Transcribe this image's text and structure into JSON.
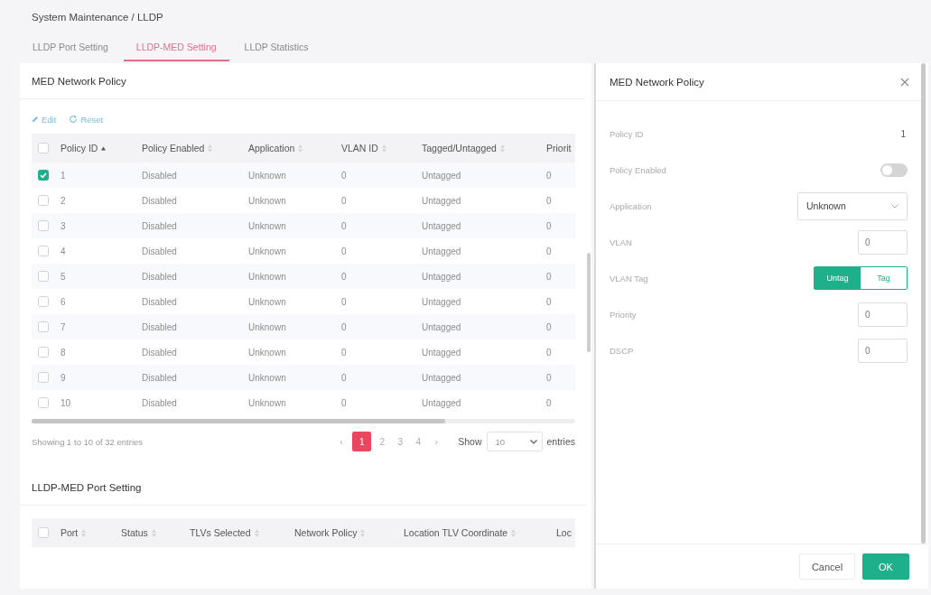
{
  "breadcrumb": "System Maintenance / LLDP",
  "tabs": [
    {
      "label": "LLDP Port Setting",
      "selected": false
    },
    {
      "label": "LLDP-MED Setting",
      "selected": true
    },
    {
      "label": "LLDP Statistics",
      "selected": false
    }
  ],
  "policy_section": {
    "title": "MED Network Policy",
    "toolbar": [
      {
        "kind": "edit",
        "label": "Edit"
      },
      {
        "kind": "reset",
        "label": "Reset"
      }
    ],
    "table": {
      "all_checked": false,
      "columns": [
        {
          "label": "Policy ID",
          "sorted": true
        },
        {
          "label": "Policy Enabled",
          "sorted": false
        },
        {
          "label": "Application",
          "sorted": false
        },
        {
          "label": "VLAN ID",
          "sorted": false
        },
        {
          "label": "Tagged/Untagged",
          "sorted": false
        },
        {
          "label": "Priorit"
        }
      ],
      "rows": [
        {
          "checked": true,
          "cells": [
            "1",
            "Disabled",
            "Unknown",
            "0",
            "Untagged",
            "0"
          ]
        },
        {
          "checked": false,
          "cells": [
            "2",
            "Disabled",
            "Unknown",
            "0",
            "Untagged",
            "0"
          ]
        },
        {
          "checked": false,
          "cells": [
            "3",
            "Disabled",
            "Unknown",
            "0",
            "Untagged",
            "0"
          ]
        },
        {
          "checked": false,
          "cells": [
            "4",
            "Disabled",
            "Unknown",
            "0",
            "Untagged",
            "0"
          ]
        },
        {
          "checked": false,
          "cells": [
            "5",
            "Disabled",
            "Unknown",
            "0",
            "Untagged",
            "0"
          ]
        },
        {
          "checked": false,
          "cells": [
            "6",
            "Disabled",
            "Unknown",
            "0",
            "Untagged",
            "0"
          ]
        },
        {
          "checked": false,
          "cells": [
            "7",
            "Disabled",
            "Unknown",
            "0",
            "Untagged",
            "0"
          ]
        },
        {
          "checked": false,
          "cells": [
            "8",
            "Disabled",
            "Unknown",
            "0",
            "Untagged",
            "0"
          ]
        },
        {
          "checked": false,
          "cells": [
            "9",
            "Disabled",
            "Unknown",
            "0",
            "Untagged",
            "0"
          ]
        },
        {
          "checked": false,
          "cells": [
            "10",
            "Disabled",
            "Unknown",
            "0",
            "Untagged",
            "0"
          ]
        }
      ]
    },
    "footer": {
      "info": "Showing 1 to 10 of 32 entries",
      "prev": "‹",
      "pages": [
        {
          "label": "1",
          "selected": true
        },
        {
          "label": "2",
          "selected": false
        },
        {
          "label": "3",
          "selected": false
        },
        {
          "label": "4",
          "selected": false
        }
      ],
      "next": "›",
      "show_label": "Show",
      "page_size": "10",
      "entries_label": "entries"
    }
  },
  "port_section": {
    "title": "LLDP-MED Port Setting",
    "table": {
      "all_checked": false,
      "columns": [
        {
          "label": "Port",
          "sorted": false
        },
        {
          "label": "Status",
          "sorted": false
        },
        {
          "label": "TLVs Selected",
          "sorted": false
        },
        {
          "label": "Network Policy",
          "sorted": false
        },
        {
          "label": "Location TLV Coordinate",
          "sorted": false
        },
        {
          "label": "Loc"
        }
      ]
    }
  },
  "drawer": {
    "title": "MED Network Policy",
    "fields": [
      {
        "kind": "text",
        "label": "Policy ID",
        "value": "1"
      },
      {
        "kind": "toggle",
        "label": "Policy Enabled",
        "on": false
      },
      {
        "kind": "select",
        "label": "Application",
        "value": "Unknown"
      },
      {
        "kind": "input",
        "label": "VLAN",
        "value": "0"
      },
      {
        "kind": "segmented",
        "label": "VLAN Tag",
        "options": [
          {
            "label": "Untag",
            "selected": true
          },
          {
            "label": "Tag",
            "selected": false
          }
        ]
      },
      {
        "kind": "input",
        "label": "Priority",
        "value": "0"
      },
      {
        "kind": "input",
        "label": "DSCP",
        "value": "0"
      }
    ],
    "buttons": [
      {
        "kind": "cancel",
        "label": "Cancel"
      },
      {
        "kind": "confirm",
        "label": "OK"
      }
    ]
  }
}
